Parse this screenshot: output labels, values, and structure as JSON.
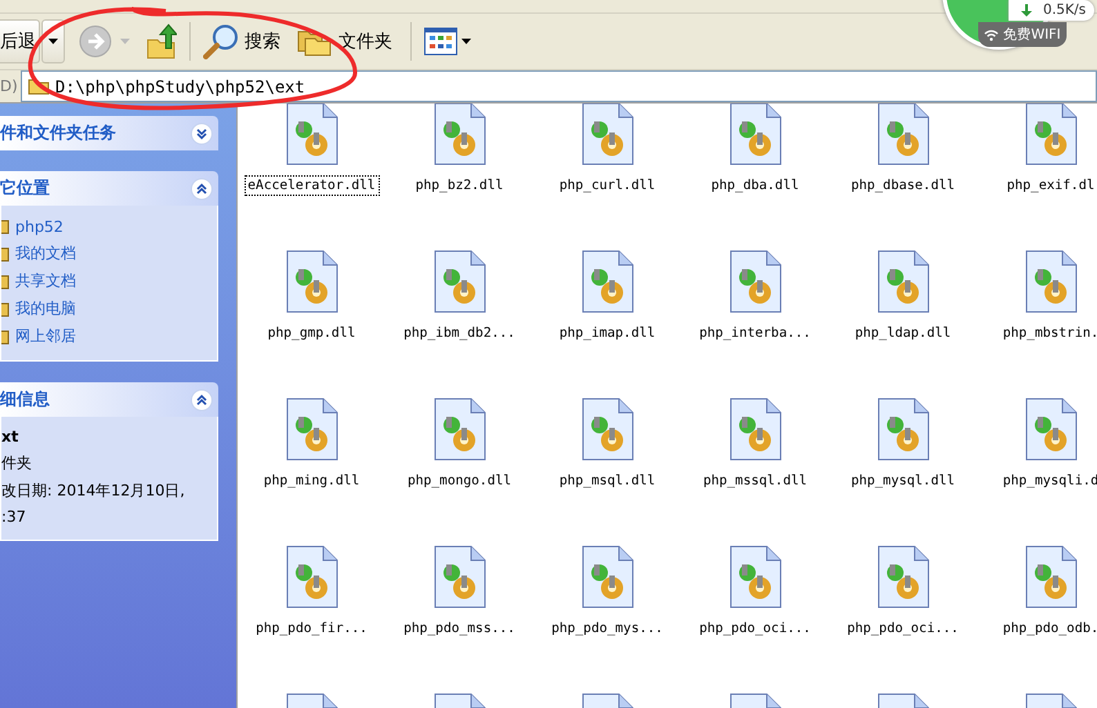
{
  "toolbar": {
    "back": {
      "label": "后退"
    },
    "forward": {
      "disabled": true
    },
    "buttons": [
      {
        "kind": "search",
        "label": "搜索"
      },
      {
        "kind": "folders",
        "label": "文件夹"
      }
    ]
  },
  "address_bar": {
    "label": "D)",
    "value": "D:\\php\\phpStudy\\php52\\ext"
  },
  "network_widget": {
    "speed": "0.5K/s",
    "wifi_label": "免费WIFI"
  },
  "sidebar": {
    "panels": [
      {
        "title": "件和文件夹任务",
        "expanded": false
      },
      {
        "title": "它位置",
        "expanded": true,
        "kind": "links",
        "items": [
          "php52",
          "我的文档",
          "共享文档",
          "我的电脑",
          "网上邻居"
        ]
      },
      {
        "title": "细信息",
        "expanded": true,
        "kind": "details",
        "name": "xt",
        "type": "件夹",
        "modified": "改日期: 2014年12月10日,",
        "time": ":37"
      }
    ]
  },
  "files": [
    {
      "label": "eAccelerator.dll",
      "selected": true
    },
    {
      "label": "php_bz2.dll",
      "selected": false
    },
    {
      "label": "php_curl.dll",
      "selected": false
    },
    {
      "label": "php_dba.dll",
      "selected": false
    },
    {
      "label": "php_dbase.dll",
      "selected": false
    },
    {
      "label": "php_exif.dl",
      "selected": false
    },
    {
      "label": "php_gmp.dll",
      "selected": false
    },
    {
      "label": "php_ibm_db2...",
      "selected": false
    },
    {
      "label": "php_imap.dll",
      "selected": false
    },
    {
      "label": "php_interba...",
      "selected": false
    },
    {
      "label": "php_ldap.dll",
      "selected": false
    },
    {
      "label": "php_mbstrin.",
      "selected": false
    },
    {
      "label": "php_ming.dll",
      "selected": false
    },
    {
      "label": "php_mongo.dll",
      "selected": false
    },
    {
      "label": "php_msql.dll",
      "selected": false
    },
    {
      "label": "php_mssql.dll",
      "selected": false
    },
    {
      "label": "php_mysql.dll",
      "selected": false
    },
    {
      "label": "php_mysqli.d",
      "selected": false
    },
    {
      "label": "php_pdo_fir...",
      "selected": false
    },
    {
      "label": "php_pdo_mss...",
      "selected": false
    },
    {
      "label": "php_pdo_mys...",
      "selected": false
    },
    {
      "label": "php_pdo_oci...",
      "selected": false
    },
    {
      "label": "php_pdo_oci...",
      "selected": false
    },
    {
      "label": "php_pdo_odb.",
      "selected": false
    },
    {
      "selected": false
    },
    {
      "selected": false
    },
    {
      "selected": false
    },
    {
      "selected": false
    },
    {
      "selected": false
    },
    {
      "selected": false
    }
  ]
}
